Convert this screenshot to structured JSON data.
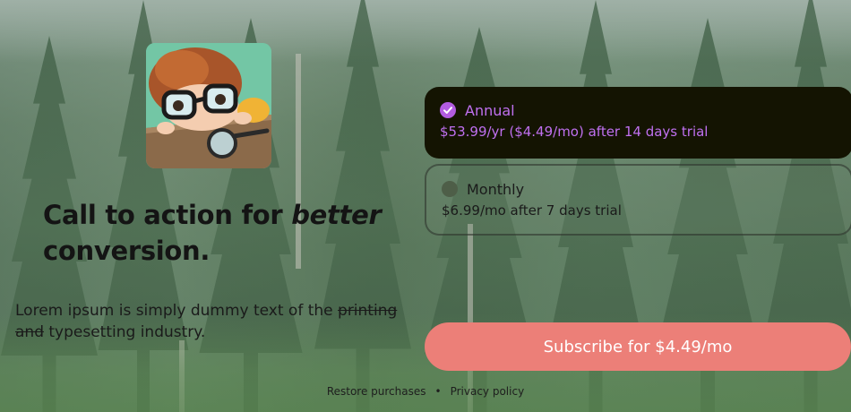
{
  "headline": {
    "part1": "Call to action for ",
    "emphasis": "better",
    "part2": " conversion."
  },
  "body": {
    "text_before": "Lorem ipsum is simply dummy text of the ",
    "struck": "printing and",
    "text_after": " typesetting industry."
  },
  "plans": [
    {
      "name": "Annual",
      "price": "$53.99/yr ($4.49/mo) after 14 days trial",
      "selected": true
    },
    {
      "name": "Monthly",
      "price": "$6.99/mo after 7 days trial",
      "selected": false
    }
  ],
  "subscribe_label": "Subscribe for $4.49/mo",
  "footer": {
    "restore": "Restore purchases",
    "separator": "•",
    "privacy": "Privacy policy"
  },
  "colors": {
    "accent": "#b25ce0",
    "button": "#ec7f78",
    "selected_plan_bg": "#141402"
  },
  "icons": {
    "app_icon": "app-icon-kid-with-magnifier",
    "selected": "checkmark-circle-icon",
    "unselected": "radio-circle-icon"
  }
}
